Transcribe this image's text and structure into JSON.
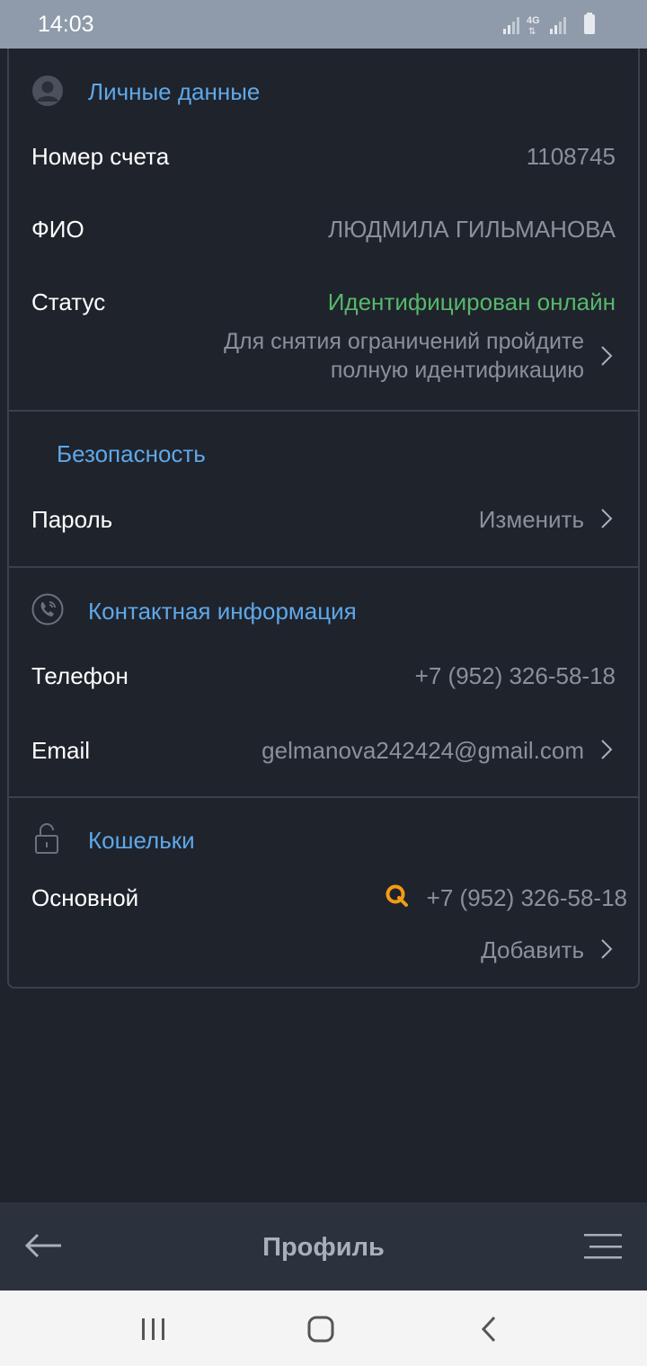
{
  "status_bar": {
    "time": "14:03",
    "network": "4G"
  },
  "personal": {
    "title": "Личные данные",
    "icon": "user-avatar-icon",
    "account_label": "Номер счета",
    "account_value": "1108745",
    "name_label": "ФИО",
    "name_value": "ЛЮДМИЛА ГИЛЬМАНОВА",
    "status_label": "Статус",
    "status_value": "Идентифицирован онлайн",
    "hint_line1": "Для снятия ограничений пройдите",
    "hint_line2": "полную идентификацию"
  },
  "security": {
    "title": "Безопасность",
    "password_label": "Пароль",
    "password_action": "Изменить"
  },
  "contact": {
    "title": "Контактная информация",
    "icon": "phone-icon",
    "phone_label": "Телефон",
    "phone_value": "+7 (952) 326-58-18",
    "email_label": "Email",
    "email_value": "gelmanova242424@gmail.com"
  },
  "wallets": {
    "title": "Кошельки",
    "icon": "lock-icon",
    "main_label": "Основной",
    "main_value": "+7 (952) 326-58-18",
    "main_icon": "qiwi-icon",
    "add_label": "Добавить"
  },
  "bottom_bar": {
    "title": "Профиль",
    "back_icon": "arrow-left-icon",
    "menu_icon": "menu-icon"
  },
  "nav_bar": {
    "recents_icon": "recents-icon",
    "home_icon": "home-icon",
    "back_icon": "back-icon"
  },
  "colors": {
    "background": "#1f232c",
    "accent": "#5fa8e8",
    "success": "#57b86a",
    "muted": "#8a919c",
    "qiwi": "#f39c12"
  }
}
